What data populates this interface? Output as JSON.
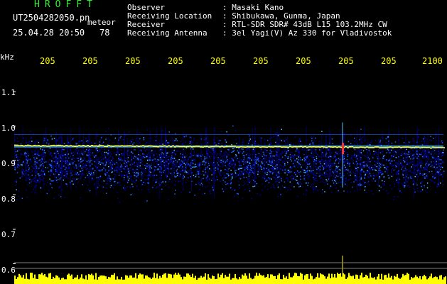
{
  "header": {
    "brand": "HROFFT",
    "filename": "UT2504282050.pn",
    "mode": "meteor",
    "datetime": "25.04.28 20:50",
    "count": "78",
    "info_labels": [
      "Observer",
      "Receiving Location",
      "Receiver",
      "Receiving Antenna"
    ],
    "info_values": [
      ": Masaki Kano",
      ": Shibukawa, Gunma, Japan",
      ": RTL-SDR SDR# 43dB L15 103.2MHz CW",
      ": 3el Yagi(V) Az 330 for Vladivostok"
    ]
  },
  "chart_data": {
    "type": "heatmap",
    "ylabel": "kHz",
    "yticks": [
      "1.1",
      "1.0",
      "0.9",
      "0.8",
      "0.7",
      "0.6"
    ],
    "ylim": [
      0.57,
      1.16
    ],
    "xticks": [
      "205",
      "205",
      "205",
      "205",
      "205",
      "205",
      "205",
      "205",
      "205",
      "2100"
    ],
    "carrier_khz": 0.945,
    "echo_band_khz": [
      0.78,
      1.0
    ],
    "spike_x_tick_index": 7,
    "colors": {
      "background": "#000000",
      "noise_low": "#0000a0",
      "noise_mid": "#1e64ff",
      "noise_high": "#50c8ff",
      "carrier": "#ffff40",
      "spike": "#ff3030",
      "amplitude_bars": "#ffff00",
      "reference_line": "#808080"
    }
  }
}
